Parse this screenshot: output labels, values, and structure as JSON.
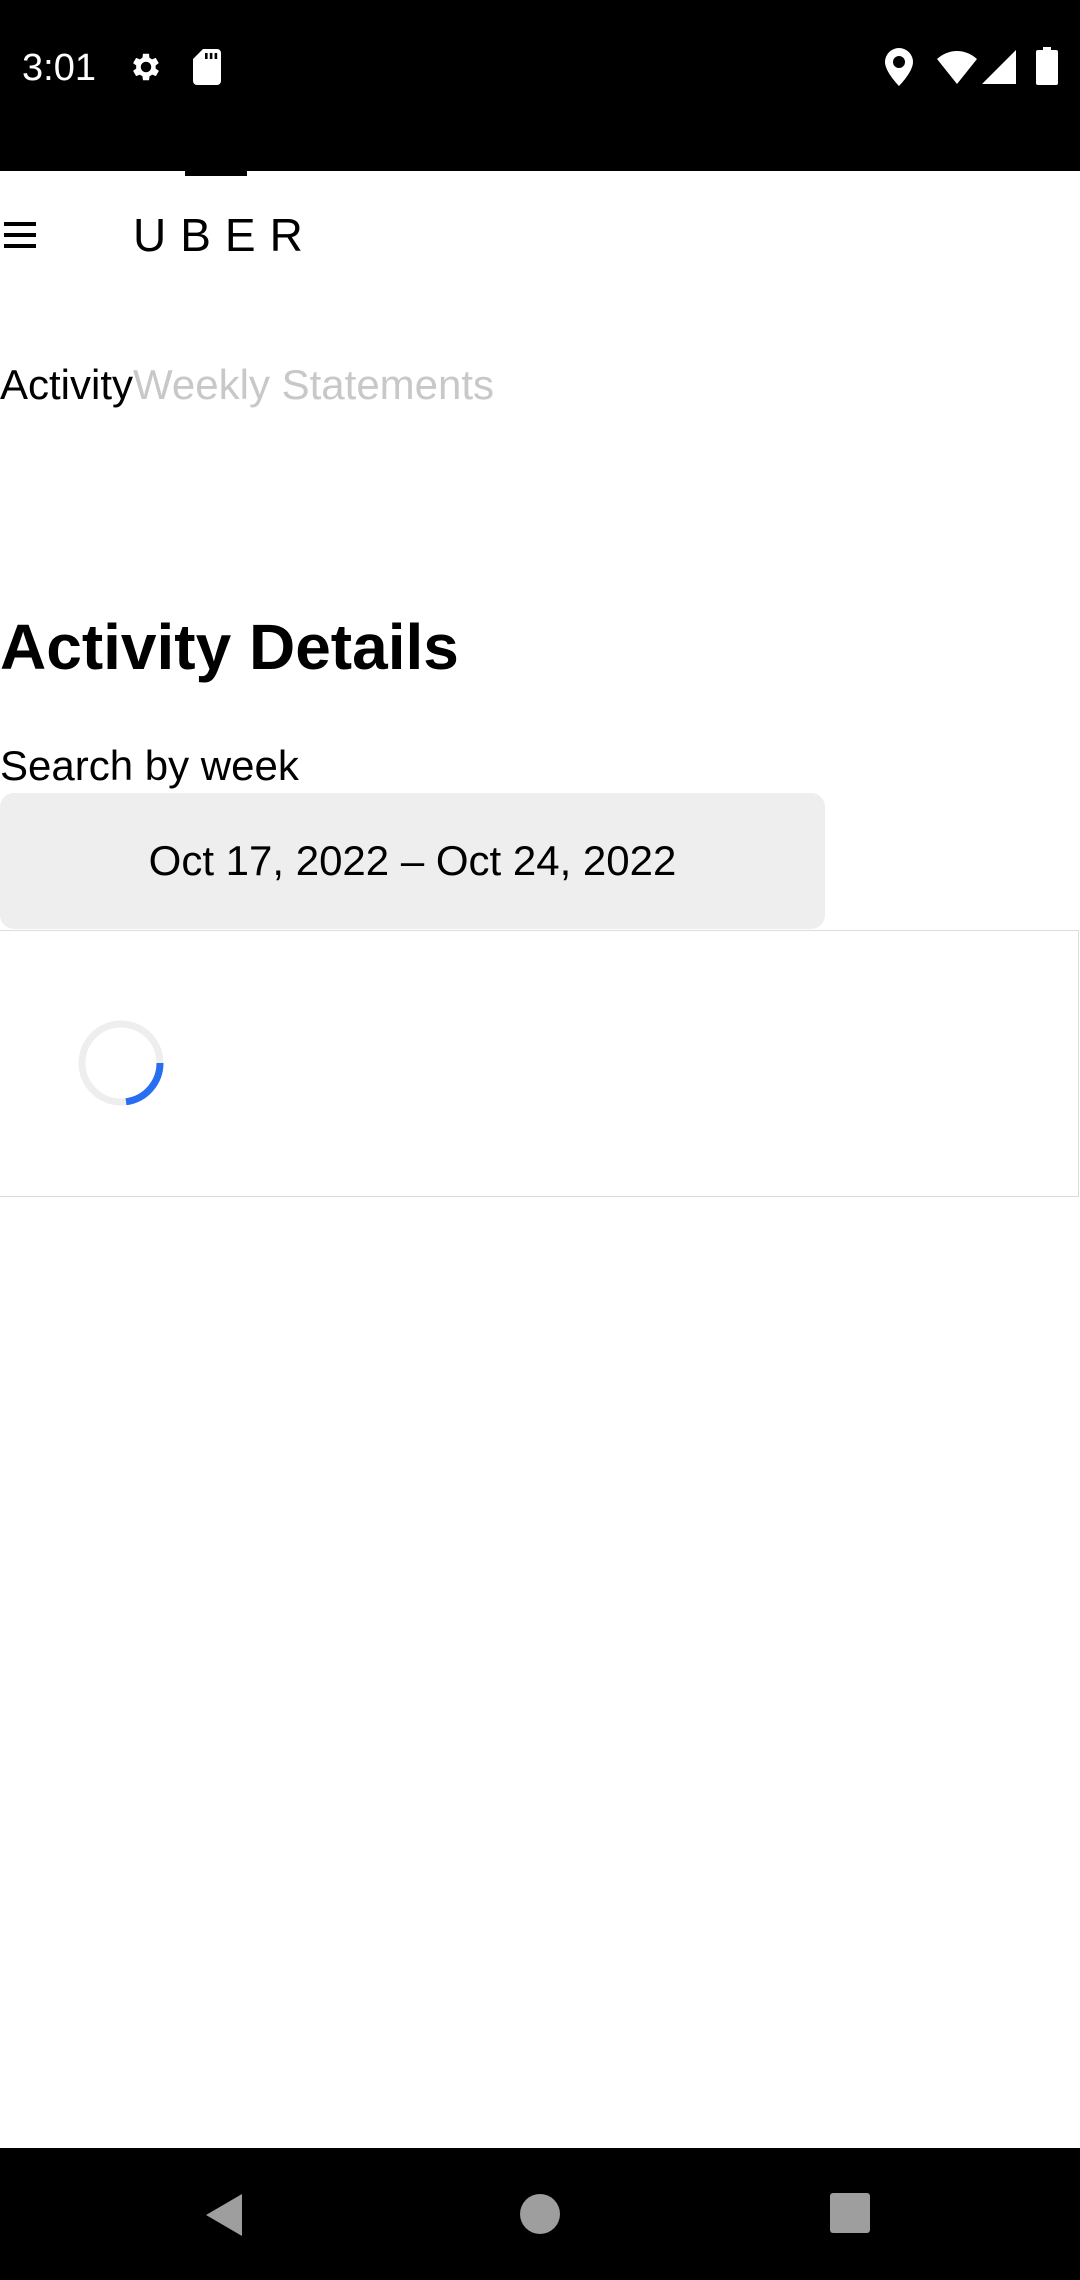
{
  "status_bar": {
    "time": "3:01",
    "icons": [
      "gear-icon",
      "sd-card-icon",
      "location-icon",
      "wifi-icon",
      "signal-icon",
      "battery-icon"
    ]
  },
  "header": {
    "logo_text": "UBER",
    "menu_icon": "hamburger-menu-icon"
  },
  "tabs": [
    {
      "label": "Activity",
      "active": true
    },
    {
      "label": "Weekly Statements",
      "active": false
    }
  ],
  "main": {
    "title": "Activity Details",
    "search_label": "Search by week",
    "week_range": "Oct 17, 2022 – Oct 24, 2022",
    "loading": true
  },
  "colors": {
    "accent": "#276EF1",
    "tab_inactive": "#C8C8C8",
    "picker_bg": "#EEEEEE"
  },
  "nav_bar": {
    "buttons": [
      "back-icon",
      "home-icon",
      "recents-icon"
    ]
  }
}
